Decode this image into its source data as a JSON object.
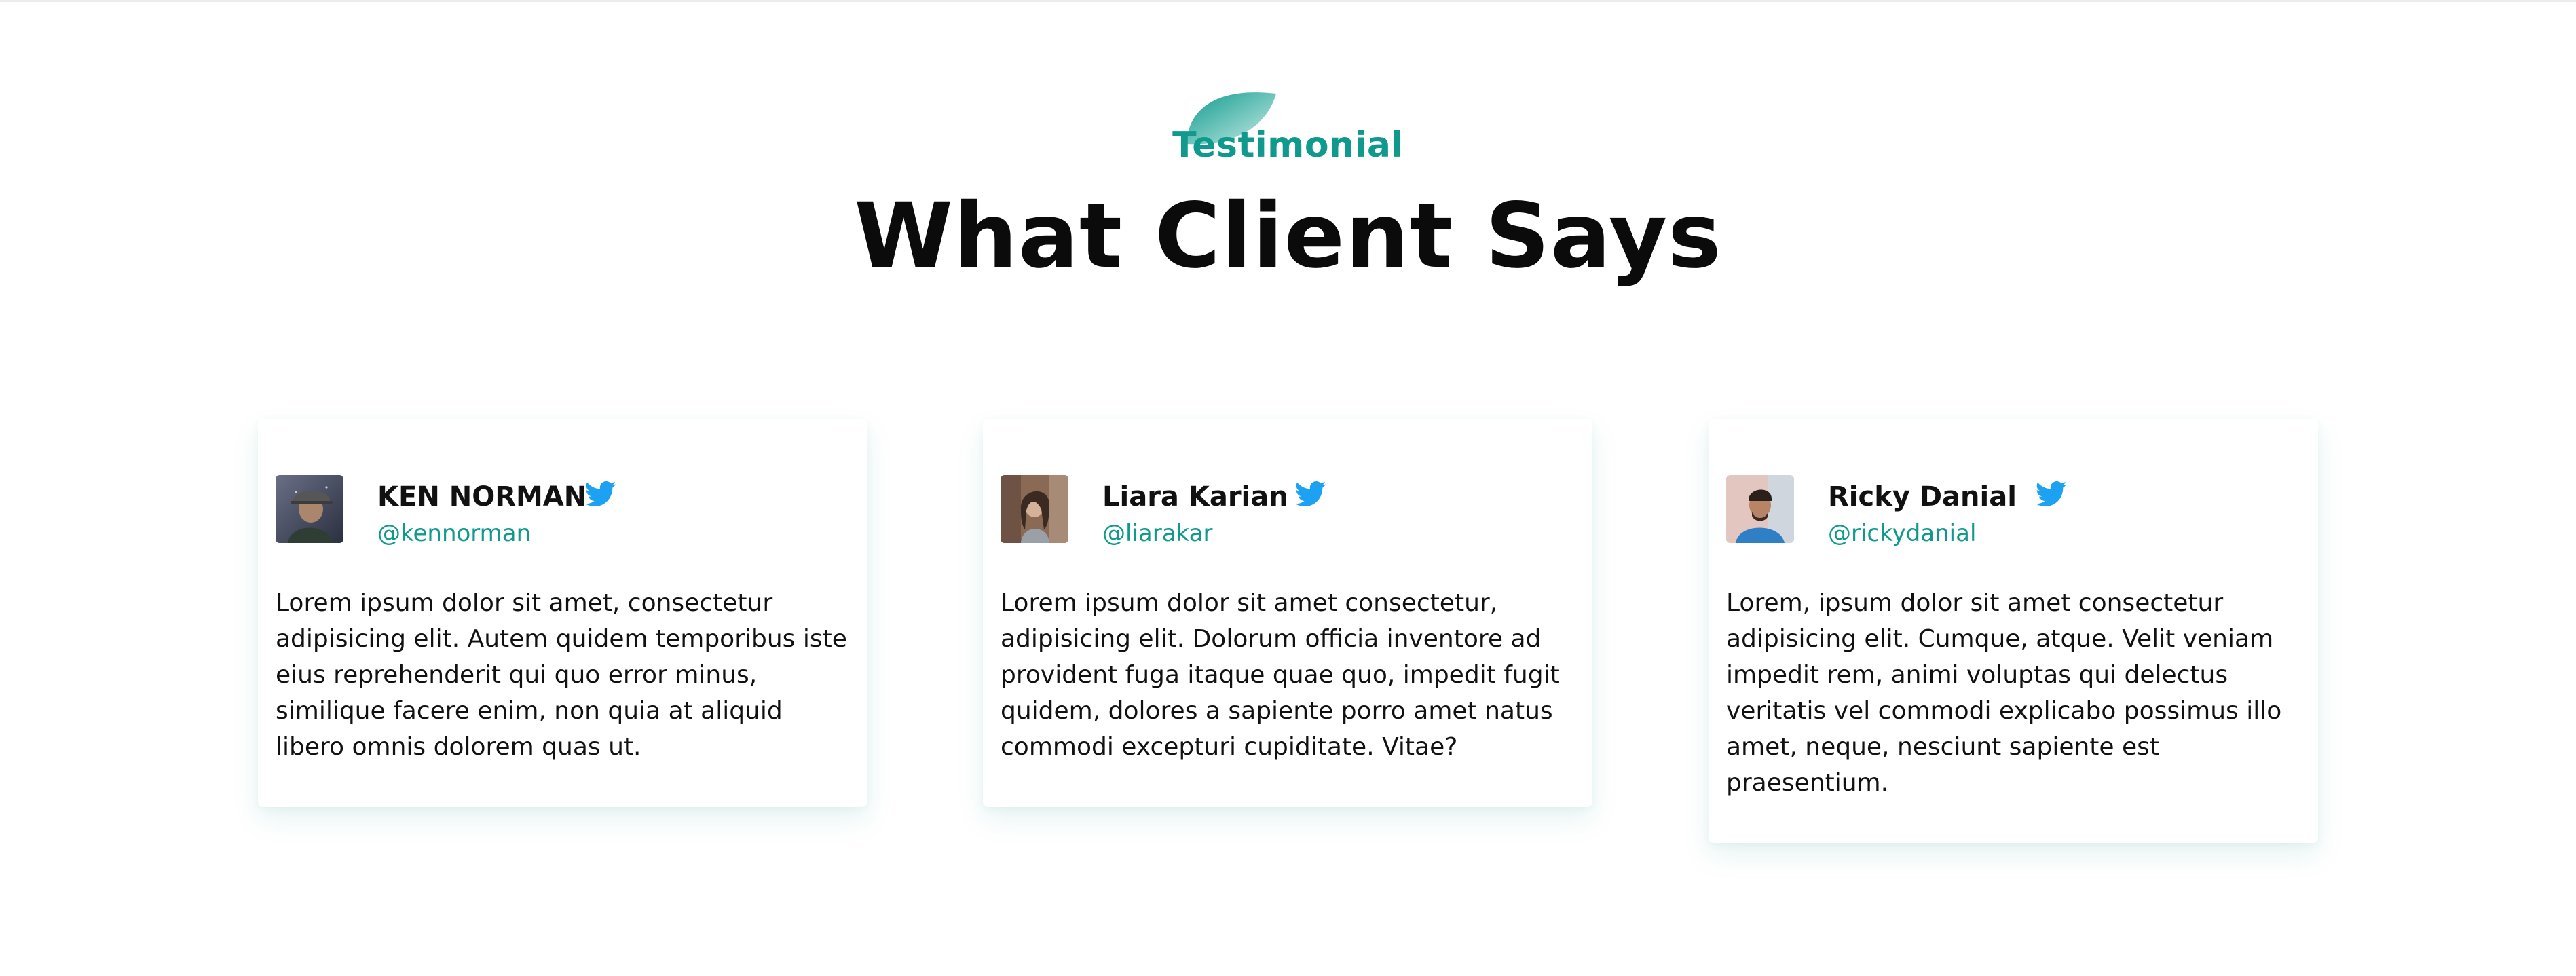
{
  "section": {
    "eyebrow": "Testimonial",
    "title": "What Client Says",
    "accent_color": "#0f9a8d",
    "twitter_color": "#1da1f2"
  },
  "testimonials": [
    {
      "name": "KEN NORMAN",
      "handle": "@kennorman",
      "icon": "twitter-icon",
      "text": "Lorem ipsum dolor sit amet, consectetur adipisicing elit. Autem quidem temporibus iste eius reprehenderit qui quo error minus, similique facere enim, non quia at aliquid libero omnis dolorem quas ut."
    },
    {
      "name": "Liara Karian",
      "handle": "@liarakar",
      "icon": "twitter-icon",
      "text": "Lorem ipsum dolor sit amet consectetur, adipisicing elit. Dolorum officia inventore ad provident fuga itaque quae quo, impedit fugit quidem, dolores a sapiente porro amet natus commodi excepturi cupiditate. Vitae?"
    },
    {
      "name": "Ricky Danial",
      "handle": "@rickydanial",
      "icon": "twitter-icon",
      "text": "Lorem, ipsum dolor sit amet consectetur adipisicing elit. Cumque, atque. Velit veniam impedit rem, animi voluptas qui delectus veritatis vel commodi explicabo possimus illo amet, neque, nesciunt sapiente est praesentium."
    }
  ]
}
